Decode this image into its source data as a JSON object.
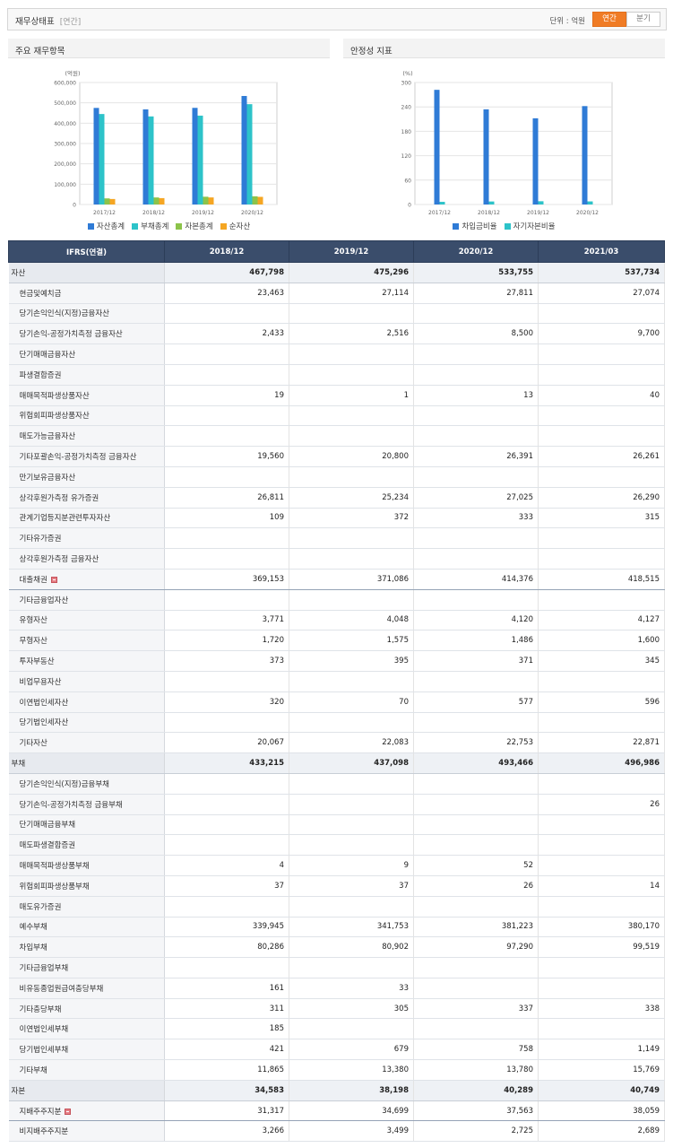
{
  "header": {
    "title": "재무상태표",
    "subtitle": "[연간]",
    "unit": "단위 : 억원",
    "toggle_annual": "연간",
    "toggle_quarter": "분기"
  },
  "colors": {
    "accent": "#f07c25",
    "series_blue": "#2f7bd6",
    "series_teal": "#2dc3c9",
    "series_green": "#8cc34a",
    "series_orange": "#f5a623",
    "table_header": "#3a4d6b"
  },
  "chart_data": [
    {
      "type": "bar",
      "panel_title": "주요 재무항목",
      "ylabel": "(억원)",
      "categories": [
        "2017/12",
        "2018/12",
        "2019/12",
        "2020/12"
      ],
      "yticks": [
        "0",
        "100,000",
        "200,000",
        "300,000",
        "400,000",
        "500,000",
        "600,000"
      ],
      "ylim": [
        0,
        600000
      ],
      "grid": true,
      "legend_position": "bottom",
      "series": [
        {
          "name": "자산총계",
          "color": "#2f7bd6",
          "values": [
            475000,
            467798,
            475296,
            533755
          ]
        },
        {
          "name": "부채총계",
          "color": "#2dc3c9",
          "values": [
            445000,
            433215,
            437098,
            493466
          ]
        },
        {
          "name": "자본총계",
          "color": "#8cc34a",
          "values": [
            30000,
            34583,
            38198,
            40289
          ]
        },
        {
          "name": "순자산",
          "color": "#f5a623",
          "values": [
            27000,
            31317,
            34699,
            37563
          ]
        }
      ]
    },
    {
      "type": "bar",
      "panel_title": "안정성 지표",
      "ylabel": "(%)",
      "categories": [
        "2017/12",
        "2018/12",
        "2019/12",
        "2020/12"
      ],
      "yticks": [
        "0",
        "60",
        "120",
        "180",
        "240",
        "300"
      ],
      "ylim": [
        0,
        300
      ],
      "grid": true,
      "legend_position": "bottom",
      "series": [
        {
          "name": "차입금비율",
          "color": "#2f7bd6",
          "values": [
            282,
            234,
            212,
            242
          ]
        },
        {
          "name": "자기자본비율",
          "color": "#2dc3c9",
          "values": [
            6.5,
            7.4,
            8.0,
            7.6
          ]
        }
      ]
    }
  ],
  "table": {
    "header": [
      "IFRS(연결)",
      "2018/12",
      "2019/12",
      "2020/12",
      "2021/03"
    ],
    "rows": [
      {
        "label": "자산",
        "values": [
          "467,798",
          "475,296",
          "533,755",
          "537,734"
        ],
        "group": true
      },
      {
        "label": "현금및예치금",
        "values": [
          "23,463",
          "27,114",
          "27,811",
          "27,074"
        ]
      },
      {
        "label": "당기손익인식(지정)금융자산",
        "values": [
          "",
          "",
          "",
          ""
        ]
      },
      {
        "label": "당기손익-공정가치측정 금융자산",
        "values": [
          "2,433",
          "2,516",
          "8,500",
          "9,700"
        ]
      },
      {
        "label": "단기매매금융자산",
        "values": [
          "",
          "",
          "",
          ""
        ]
      },
      {
        "label": "파생결합증권",
        "values": [
          "",
          "",
          "",
          ""
        ]
      },
      {
        "label": "매매목적파생상품자산",
        "values": [
          "19",
          "1",
          "13",
          "40"
        ]
      },
      {
        "label": "위험회피파생상품자산",
        "values": [
          "",
          "",
          "",
          ""
        ]
      },
      {
        "label": "매도가능금융자산",
        "values": [
          "",
          "",
          "",
          ""
        ]
      },
      {
        "label": "기타포괄손익-공정가치측정 금융자산",
        "values": [
          "19,560",
          "20,800",
          "26,391",
          "26,261"
        ]
      },
      {
        "label": "만기보유금융자산",
        "values": [
          "",
          "",
          "",
          ""
        ]
      },
      {
        "label": "상각후원가측정 유가증권",
        "values": [
          "26,811",
          "25,234",
          "27,025",
          "26,290"
        ]
      },
      {
        "label": "관계기업등지분관련투자자산",
        "values": [
          "109",
          "372",
          "333",
          "315"
        ]
      },
      {
        "label": "기타유가증권",
        "values": [
          "",
          "",
          "",
          ""
        ]
      },
      {
        "label": "상각후원가측정 금융자산",
        "values": [
          "",
          "",
          "",
          ""
        ]
      },
      {
        "label": "대출채권",
        "values": [
          "369,153",
          "371,086",
          "414,376",
          "418,515"
        ],
        "expand": true,
        "sep": true
      },
      {
        "label": "기타금융업자산",
        "values": [
          "",
          "",
          "",
          ""
        ]
      },
      {
        "label": "유형자산",
        "values": [
          "3,771",
          "4,048",
          "4,120",
          "4,127"
        ]
      },
      {
        "label": "무형자산",
        "values": [
          "1,720",
          "1,575",
          "1,486",
          "1,600"
        ]
      },
      {
        "label": "투자부동산",
        "values": [
          "373",
          "395",
          "371",
          "345"
        ]
      },
      {
        "label": "비업무용자산",
        "values": [
          "",
          "",
          "",
          ""
        ]
      },
      {
        "label": "이연법인세자산",
        "values": [
          "320",
          "70",
          "577",
          "596"
        ]
      },
      {
        "label": "당기법인세자산",
        "values": [
          "",
          "",
          "",
          ""
        ]
      },
      {
        "label": "기타자산",
        "values": [
          "20,067",
          "22,083",
          "22,753",
          "22,871"
        ]
      },
      {
        "label": "부채",
        "values": [
          "433,215",
          "437,098",
          "493,466",
          "496,986"
        ],
        "group": true
      },
      {
        "label": "당기손익인식(지정)금융부채",
        "values": [
          "",
          "",
          "",
          ""
        ]
      },
      {
        "label": "당기손익-공정가치측정 금융부채",
        "values": [
          "",
          "",
          "",
          "26"
        ]
      },
      {
        "label": "단기매매금융부채",
        "values": [
          "",
          "",
          "",
          ""
        ]
      },
      {
        "label": "매도파생결합증권",
        "values": [
          "",
          "",
          "",
          ""
        ]
      },
      {
        "label": "매매목적파생상품부채",
        "values": [
          "4",
          "9",
          "52",
          ""
        ]
      },
      {
        "label": "위험회피파생상품부채",
        "values": [
          "37",
          "37",
          "26",
          "14"
        ]
      },
      {
        "label": "매도유가증권",
        "values": [
          "",
          "",
          "",
          ""
        ]
      },
      {
        "label": "예수부채",
        "values": [
          "339,945",
          "341,753",
          "381,223",
          "380,170"
        ]
      },
      {
        "label": "차입부채",
        "values": [
          "80,286",
          "80,902",
          "97,290",
          "99,519"
        ]
      },
      {
        "label": "기타금융업부채",
        "values": [
          "",
          "",
          "",
          ""
        ]
      },
      {
        "label": "비유동종업원급여충당부채",
        "values": [
          "161",
          "33",
          "",
          ""
        ]
      },
      {
        "label": "기타충당부채",
        "values": [
          "311",
          "305",
          "337",
          "338"
        ]
      },
      {
        "label": "이연법인세부채",
        "values": [
          "185",
          "",
          "",
          ""
        ]
      },
      {
        "label": "당기법인세부채",
        "values": [
          "421",
          "679",
          "758",
          "1,149"
        ]
      },
      {
        "label": "기타부채",
        "values": [
          "11,865",
          "13,380",
          "13,780",
          "15,769"
        ]
      },
      {
        "label": "자본",
        "values": [
          "34,583",
          "38,198",
          "40,289",
          "40,749"
        ],
        "group": true
      },
      {
        "label": "지배주주지분",
        "values": [
          "31,317",
          "34,699",
          "37,563",
          "38,059"
        ],
        "expand": true,
        "sep": true
      },
      {
        "label": "비지배주주지분",
        "values": [
          "3,266",
          "3,499",
          "2,725",
          "2,689"
        ]
      }
    ]
  }
}
